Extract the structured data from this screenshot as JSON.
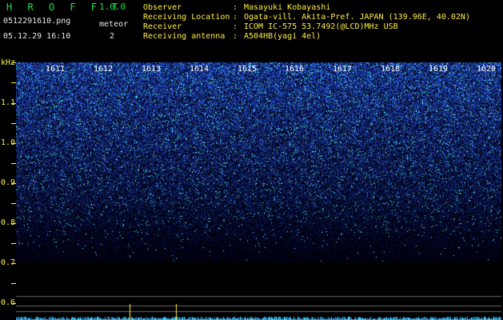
{
  "header": {
    "app_title": "H R O F F T",
    "app_version": "1.0.0",
    "filename": "0512291610.png",
    "datetime": "05.12.29 16:10",
    "mode_label": "meteor",
    "meteor_count": "2"
  },
  "info": {
    "observer_label": "Observer",
    "observer_value": "Masayuki Kobayashi",
    "location_label": "Receiving Location",
    "location_value": "Ogata-vill. Akita-Pref. JAPAN (139.96E, 40.02N)",
    "receiver_label": "Receiver",
    "receiver_value": "ICOM IC-575 53.7492(@LCD)MHz USB",
    "antenna_label": "Receiving antenna",
    "antenna_value": "A504HB(yagi 4el)",
    "separator": ":"
  },
  "spectrogram": {
    "y_unit": "kHz",
    "y_ticks": [
      "1.1",
      "1.0",
      "0.9",
      "0.8",
      "0.7",
      "0.6"
    ],
    "time_labels": [
      "1611",
      "1612",
      "1613",
      "1614",
      "1615",
      "1616",
      "1617",
      "1618",
      "1619",
      "1620"
    ],
    "colors": {
      "noise_high": "#3050ff",
      "noise_low": "#0a0a40",
      "speck": "#60ffff",
      "meteor_mark": "#ffee44",
      "baseline": "#40d0ff"
    }
  }
}
